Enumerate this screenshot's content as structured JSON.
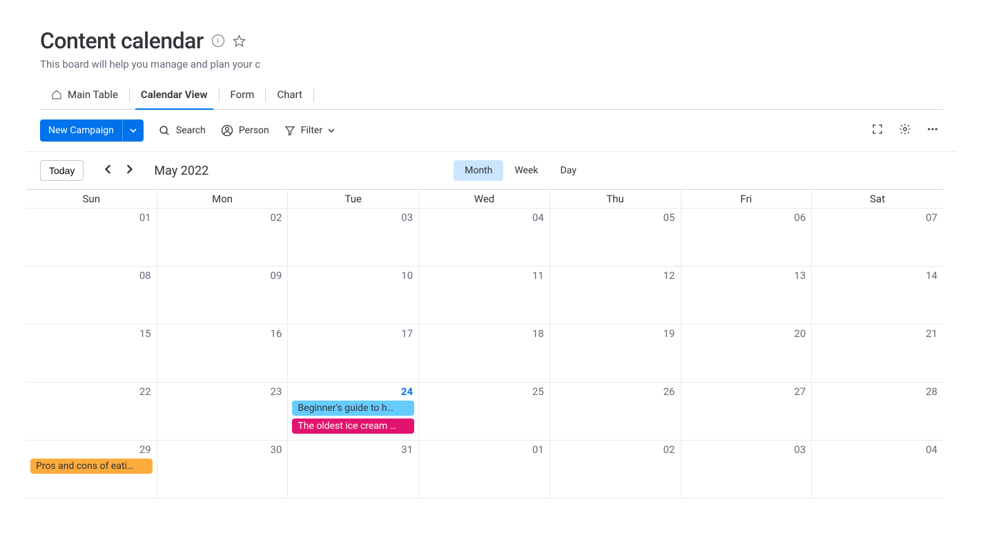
{
  "header": {
    "title": "Content calendar",
    "subtitle": "This board will help you manage and plan your conte"
  },
  "tabs": [
    {
      "label": "Main Table",
      "icon": "home"
    },
    {
      "label": "Calendar View",
      "active": true
    },
    {
      "label": "Form"
    },
    {
      "label": "Chart"
    }
  ],
  "toolbar": {
    "new_campaign": "New Campaign",
    "search": "Search",
    "person": "Person",
    "filter": "Filter"
  },
  "calendar_nav": {
    "today": "Today",
    "month_label": "May 2022",
    "views": {
      "month": "Month",
      "week": "Week",
      "day": "Day"
    },
    "active_view": "month"
  },
  "dow": [
    "Sun",
    "Mon",
    "Tue",
    "Wed",
    "Thu",
    "Fri",
    "Sat"
  ],
  "weeks": [
    [
      {
        "n": "01"
      },
      {
        "n": "02"
      },
      {
        "n": "03"
      },
      {
        "n": "04"
      },
      {
        "n": "05"
      },
      {
        "n": "06"
      },
      {
        "n": "07"
      }
    ],
    [
      {
        "n": "08"
      },
      {
        "n": "09"
      },
      {
        "n": "10"
      },
      {
        "n": "11"
      },
      {
        "n": "12"
      },
      {
        "n": "13"
      },
      {
        "n": "14"
      }
    ],
    [
      {
        "n": "15"
      },
      {
        "n": "16"
      },
      {
        "n": "17"
      },
      {
        "n": "18"
      },
      {
        "n": "19"
      },
      {
        "n": "20"
      },
      {
        "n": "21"
      }
    ],
    [
      {
        "n": "22"
      },
      {
        "n": "23"
      },
      {
        "n": "24",
        "today": true,
        "events": [
          {
            "label": "Beginner's guide to h…",
            "color": "blue"
          },
          {
            "label": "The oldest ice cream …",
            "color": "pink"
          }
        ]
      },
      {
        "n": "25"
      },
      {
        "n": "26"
      },
      {
        "n": "27"
      },
      {
        "n": "28"
      }
    ],
    [
      {
        "n": "29",
        "events": [
          {
            "label": "Pros and cons of eati…",
            "color": "orange"
          }
        ]
      },
      {
        "n": "30"
      },
      {
        "n": "31"
      },
      {
        "n": "01"
      },
      {
        "n": "02"
      },
      {
        "n": "03"
      },
      {
        "n": "04"
      }
    ]
  ]
}
